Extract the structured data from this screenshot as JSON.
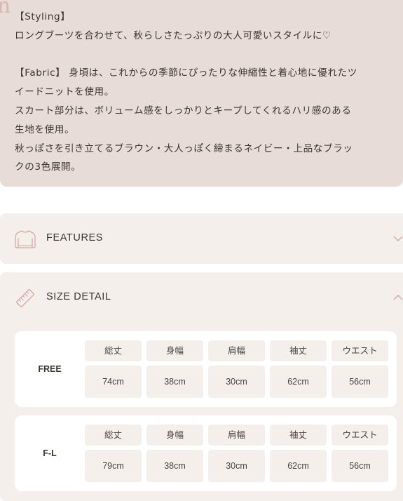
{
  "description": {
    "deco_letter": "n",
    "lines": [
      "【Styling】",
      "ロングブーツを合わせて、秋らしさたっぷりの大人可愛いスタイルに♡",
      "",
      "【Fabric】 身頃は、これからの季節にぴったりな伸縮性と着心地に優れたツ",
      "イードニットを使用。",
      "スカート部分は、ボリューム感をしっかりとキープしてくれるハリ感のある",
      "生地を使用。",
      "秋っぽさを引き立てるブラウン・大人っぽく締まるネイビー・上品なブラッ",
      "クの3色展開。"
    ]
  },
  "features": {
    "title": "FEATURES",
    "icon": "sweater-icon",
    "state": "collapsed"
  },
  "size_detail": {
    "title": "SIZE DETAIL",
    "icon": "ruler-icon",
    "state": "expanded",
    "headers": [
      "総丈",
      "身幅",
      "肩幅",
      "袖丈",
      "ウエスト"
    ],
    "sizes": [
      {
        "name": "FREE",
        "values": [
          "74cm",
          "38cm",
          "30cm",
          "62cm",
          "56cm"
        ]
      },
      {
        "name": "F-L",
        "values": [
          "79cm",
          "38cm",
          "30cm",
          "62cm",
          "56cm"
        ]
      }
    ]
  },
  "colors": {
    "panel_bg": "#e8dcd8",
    "accordion_bg": "#f5efec",
    "icon": "#d4aaa0",
    "text": "#3c3432"
  }
}
